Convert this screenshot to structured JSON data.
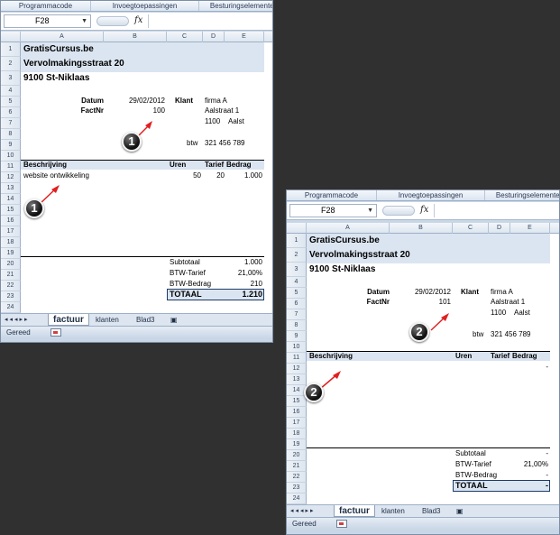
{
  "ribbon": {
    "tab_developer": "Programmacode",
    "tab_addins": "Invoegtoepassingen",
    "tab_controls": "Besturingselementen"
  },
  "formula_bar": {
    "cell_ref": "F28",
    "fx_label": "fx"
  },
  "columns": [
    "A",
    "B",
    "C",
    "D",
    "E"
  ],
  "invoice": {
    "company": "GratisCursus.be",
    "street": "Vervolmakingsstraat 20",
    "city": "9100 St-Niklaas",
    "datum_label": "Datum",
    "datum": "29/02/2012",
    "klant_label": "Klant",
    "klant": "firma A",
    "factnr_label": "FactNr",
    "klant_street": "Aalstraat 1",
    "klant_postcode": "1100",
    "klant_city": "Aalst",
    "btw_label": "btw",
    "btw": "321 456 789",
    "hdr_desc": "Beschrijving",
    "hdr_hours": "Uren",
    "hdr_rate": "Tarief",
    "hdr_amount": "Bedrag",
    "subtotal_label": "Subtotaal",
    "vat_rate_label": "BTW-Tarief",
    "vat_amount_label": "BTW-Bedrag",
    "total_label": "TOTAAL",
    "vat_rate": "21,00%"
  },
  "window1": {
    "factnr": "100",
    "line_desc": "website ontwikkeling",
    "line_hours": "50",
    "line_rate": "20",
    "line_amount": "1.000",
    "subtotal": "1.000",
    "vat_amount": "210",
    "total": "1.210",
    "marker_1": "1",
    "marker_2": "1"
  },
  "window2": {
    "factnr": "101",
    "line_amount": "-",
    "subtotal": "-",
    "vat_amount": "-",
    "total": "-",
    "marker_1": "2",
    "marker_2": "2"
  },
  "sheet_tabs": [
    "factuur",
    "klanten",
    "Blad3"
  ],
  "status": "Gereed"
}
